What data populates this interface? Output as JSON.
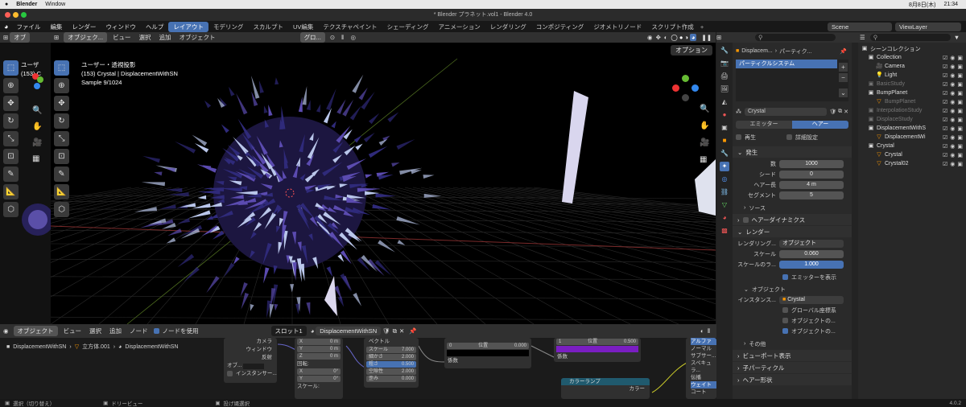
{
  "mac": {
    "app": "Blender",
    "menu_window": "Window",
    "date": "8月8日(木)",
    "time": "21:34"
  },
  "window_title": "* Blender プラネット.vol1 - Blender 4.0",
  "topbar": {
    "menus": [
      "ファイル",
      "編集",
      "レンダー",
      "ウィンドウ",
      "ヘルプ"
    ],
    "workspaces": [
      "レイアウト",
      "モデリング",
      "スカルプト",
      "UV編集",
      "テクスチャペイント",
      "シェーディング",
      "アニメーション",
      "レンダリング",
      "コンポジティング",
      "ジオメトリノード",
      "スクリプト作成"
    ],
    "scene": "Scene",
    "view_layer": "ViewLayer"
  },
  "viewport_left": {
    "mode": "オブ",
    "overlay_text": "ユーザ",
    "frame": "(153) C"
  },
  "viewport": {
    "mode": "オブジェク...",
    "menus": [
      "ビュー",
      "選択",
      "追加",
      "オブジェクト"
    ],
    "transform": "グロ...",
    "options": "オプション",
    "overlay_line1": "ユーザー・透視投影",
    "overlay_line2": "(153) Crystal | DisplacementWithSN",
    "overlay_line3": "Sample 9/1024"
  },
  "props": {
    "breadcrumb1": "Displacem...",
    "breadcrumb2": "パーティク...",
    "system": "パーティクルシステム",
    "settings_name": "Crystal",
    "tab_emitter": "エミッター",
    "tab_hair": "ヘアー",
    "regen": "再生",
    "advanced": "詳細設定",
    "sec_emission": "発生",
    "number_label": "数",
    "number": "1000",
    "seed_label": "シード",
    "seed": "0",
    "hair_len_label": "ヘアー長",
    "hair_len": "4 m",
    "segments_label": "セグメント",
    "segments": "5",
    "source": "ソース",
    "hair_dyn": "ヘアーダイナミクス",
    "sec_render": "レンダー",
    "render_as_label": "レンダリング...",
    "render_as": "オブジェクト",
    "scale_label": "スケール",
    "scale": "0.060",
    "scale_rand_label": "スケールのラ...",
    "scale_rand": "1.000",
    "show_emitter": "エミッターを表示",
    "sec_object": "オブジェクト",
    "instance_label": "インスタンス...",
    "instance": "Crystal",
    "global_coords": "グローバル座標系",
    "object_rot": "オブジェクトの...",
    "object_scale": "オブジェクトの...",
    "other": "その他",
    "viewport_display": "ビューポート表示",
    "children": "子パーティクル",
    "hair_shape": "ヘアー形状"
  },
  "outliner": {
    "title": "シーンコレクション",
    "rows": [
      {
        "name": "Collection",
        "indent": 0,
        "type": "coll",
        "dim": false
      },
      {
        "name": "Camera",
        "indent": 1,
        "type": "cam",
        "dim": false
      },
      {
        "name": "Light",
        "indent": 1,
        "type": "light",
        "dim": false
      },
      {
        "name": "BasicStudy",
        "indent": 0,
        "type": "coll",
        "dim": true
      },
      {
        "name": "BumpPlanet",
        "indent": 0,
        "type": "coll",
        "dim": false
      },
      {
        "name": "BumpPlanet",
        "indent": 1,
        "type": "obj",
        "dim": true
      },
      {
        "name": "InterpolationStudy",
        "indent": 0,
        "type": "coll",
        "dim": true
      },
      {
        "name": "DisplaceStudy",
        "indent": 0,
        "type": "coll",
        "dim": true
      },
      {
        "name": "DisplacementWithS",
        "indent": 0,
        "type": "coll",
        "dim": false
      },
      {
        "name": "DisplacementWi",
        "indent": 1,
        "type": "obj",
        "dim": false
      },
      {
        "name": "Crystal",
        "indent": 0,
        "type": "coll",
        "dim": false
      },
      {
        "name": "Crystal",
        "indent": 1,
        "type": "obj",
        "dim": false
      },
      {
        "name": "Crystal02",
        "indent": 1,
        "type": "obj",
        "dim": false
      }
    ]
  },
  "node": {
    "mode": "オブジェクト",
    "menus": [
      "ビュー",
      "選択",
      "追加",
      "ノード"
    ],
    "use_nodes": "ノードを使用",
    "slot": "スロット1",
    "material": "DisplacementWithSN",
    "bc1": "DisplacementWithSN",
    "bc2": "立方体.001",
    "bc3": "DisplacementWithSN",
    "n1": {
      "labels": [
        "カメラ",
        "ウィンドウ",
        "反射"
      ],
      "obj": "オブ...",
      "inst": "インスタンサー..."
    },
    "n2": {
      "x": "X",
      "y": "Y",
      "z": "Z",
      "v0": "0 m",
      "rot": "回転:",
      "r0": "0°",
      "scale": "スケール:"
    },
    "n3": {
      "vector": "ベクトル",
      "f1": "スケール",
      "v1": "7.000",
      "f2": "細かさ",
      "v2": "2.000",
      "f3": "粗さ",
      "v3": "0.500",
      "f4": "空隙性",
      "v4": "2.000",
      "f5": "歪み",
      "v5": "0.000"
    },
    "n4": {
      "a": "0",
      "b": "位置",
      "c": "0.000",
      "coef": "係数"
    },
    "n5": {
      "a": "1",
      "b": "位置",
      "c": "0.500",
      "coef": "係数"
    },
    "n6": {
      "title": "カラーランプ",
      "color": "カラー"
    },
    "n7": {
      "a": "アルファ",
      "b": "ノーマル",
      "c": "サブサー...",
      "d": "スペキュラ...",
      "e": "伝播",
      "f": "ウェイト",
      "g": "コート"
    }
  },
  "status": {
    "select": "選択（切り替え）",
    "pan": "ドリービュー",
    "lasso": "投げ縄選択",
    "version": "4.0.2"
  }
}
